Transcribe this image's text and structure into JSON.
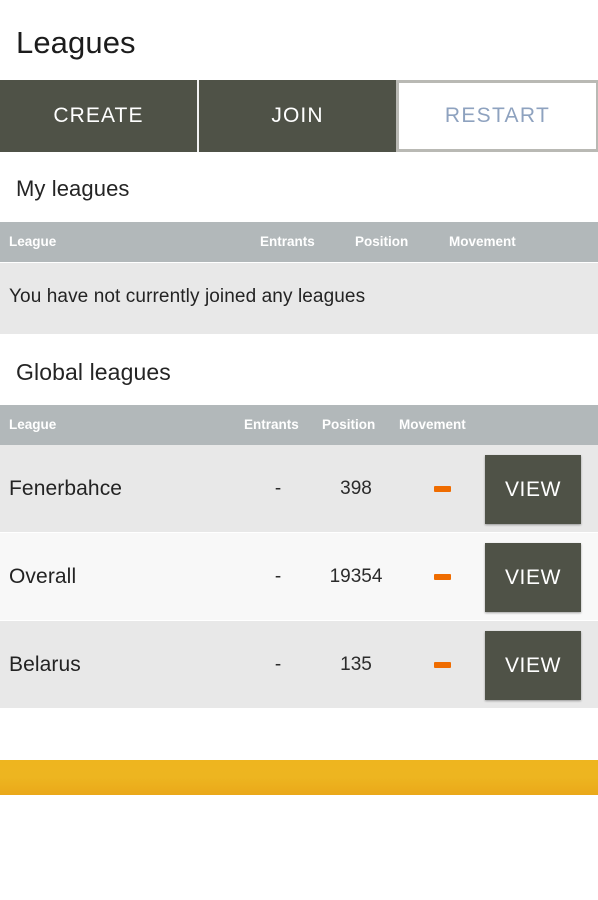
{
  "header": {
    "title": "Leagues"
  },
  "tabs": [
    {
      "label": "CREATE",
      "name": "tab-create",
      "state": "default"
    },
    {
      "label": "JOIN",
      "name": "tab-join",
      "state": "default"
    },
    {
      "label": "RESTART",
      "name": "tab-restart",
      "state": "selected"
    }
  ],
  "my_leagues": {
    "heading": "My leagues",
    "columns": [
      "League",
      "Entrants",
      "Position",
      "Movement"
    ],
    "empty_message": "You have not currently joined any leagues",
    "rows": []
  },
  "global_leagues": {
    "heading": "Global leagues",
    "columns": [
      "League",
      "Entrants",
      "Position",
      "Movement"
    ],
    "action_label": "VIEW",
    "rows": [
      {
        "league": "Fenerbahce",
        "entrants": "-",
        "position": "398",
        "movement": "none",
        "action": "VIEW"
      },
      {
        "league": "Overall",
        "entrants": "-",
        "position": "19354",
        "movement": "none",
        "action": "VIEW"
      },
      {
        "league": "Belarus",
        "entrants": "-",
        "position": "135",
        "movement": "none",
        "action": "VIEW"
      }
    ]
  },
  "colors": {
    "tab_dark": "#4f5247",
    "tab_selected_text": "#8ea2bf",
    "table_header_gray": "#b2b8ba",
    "row_odd": "#e8e8e8",
    "row_even": "#f8f8f8",
    "movement_orange": "#ef6c00",
    "bottom_banner_yellow": "#edb520"
  }
}
